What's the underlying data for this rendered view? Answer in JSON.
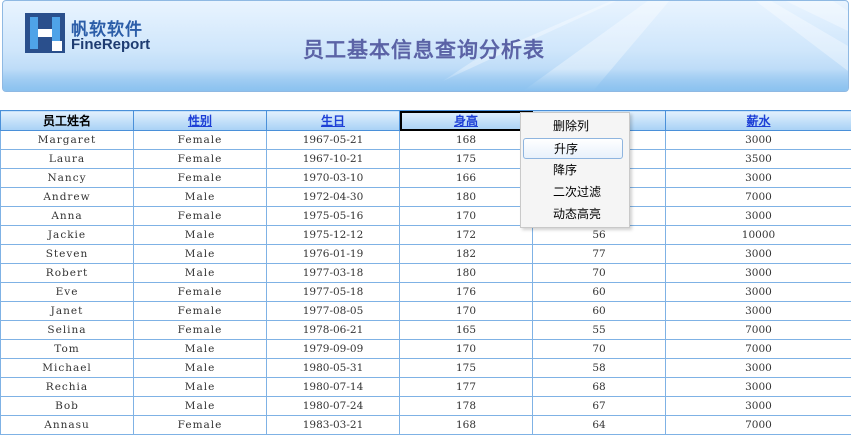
{
  "header": {
    "logo_cn": "帆软软件",
    "logo_en": "FineReport",
    "title": "员工基本信息查询分析表"
  },
  "table": {
    "columns": [
      {
        "label": "员工姓名",
        "link": false
      },
      {
        "label": "性别",
        "link": true
      },
      {
        "label": "生日",
        "link": true
      },
      {
        "label": "身高",
        "link": true,
        "selected": true
      },
      {
        "label": "",
        "link": true
      },
      {
        "label": "薪水",
        "link": true
      }
    ],
    "rows": [
      [
        "Margaret",
        "Female",
        "1967-05-21",
        "168",
        "",
        "3000"
      ],
      [
        "Laura",
        "Female",
        "1967-10-21",
        "175",
        "",
        "3500"
      ],
      [
        "Nancy",
        "Female",
        "1970-03-10",
        "166",
        "",
        "3000"
      ],
      [
        "Andrew",
        "Male",
        "1972-04-30",
        "180",
        "",
        "7000"
      ],
      [
        "Anna",
        "Female",
        "1975-05-16",
        "170",
        "",
        "3000"
      ],
      [
        "Jackie",
        "Male",
        "1975-12-12",
        "172",
        "56",
        "10000"
      ],
      [
        "Steven",
        "Male",
        "1976-01-19",
        "182",
        "77",
        "3000"
      ],
      [
        "Robert",
        "Male",
        "1977-03-18",
        "180",
        "70",
        "3000"
      ],
      [
        "Eve",
        "Female",
        "1977-05-18",
        "176",
        "60",
        "3000"
      ],
      [
        "Janet",
        "Female",
        "1977-08-05",
        "170",
        "60",
        "3000"
      ],
      [
        "Selina",
        "Female",
        "1978-06-21",
        "165",
        "55",
        "7000"
      ],
      [
        "Tom",
        "Male",
        "1979-09-09",
        "170",
        "70",
        "7000"
      ],
      [
        "Michael",
        "Male",
        "1980-05-31",
        "175",
        "58",
        "3000"
      ],
      [
        "Rechia",
        "Male",
        "1980-07-14",
        "177",
        "68",
        "3000"
      ],
      [
        "Bob",
        "Male",
        "1980-07-24",
        "178",
        "67",
        "3000"
      ],
      [
        "Annasu",
        "Female",
        "1983-03-21",
        "168",
        "64",
        "7000"
      ]
    ]
  },
  "context_menu": {
    "items": [
      "删除列",
      "升序",
      "降序",
      "二次过滤",
      "动态高亮"
    ],
    "hovered_index": 1
  }
}
